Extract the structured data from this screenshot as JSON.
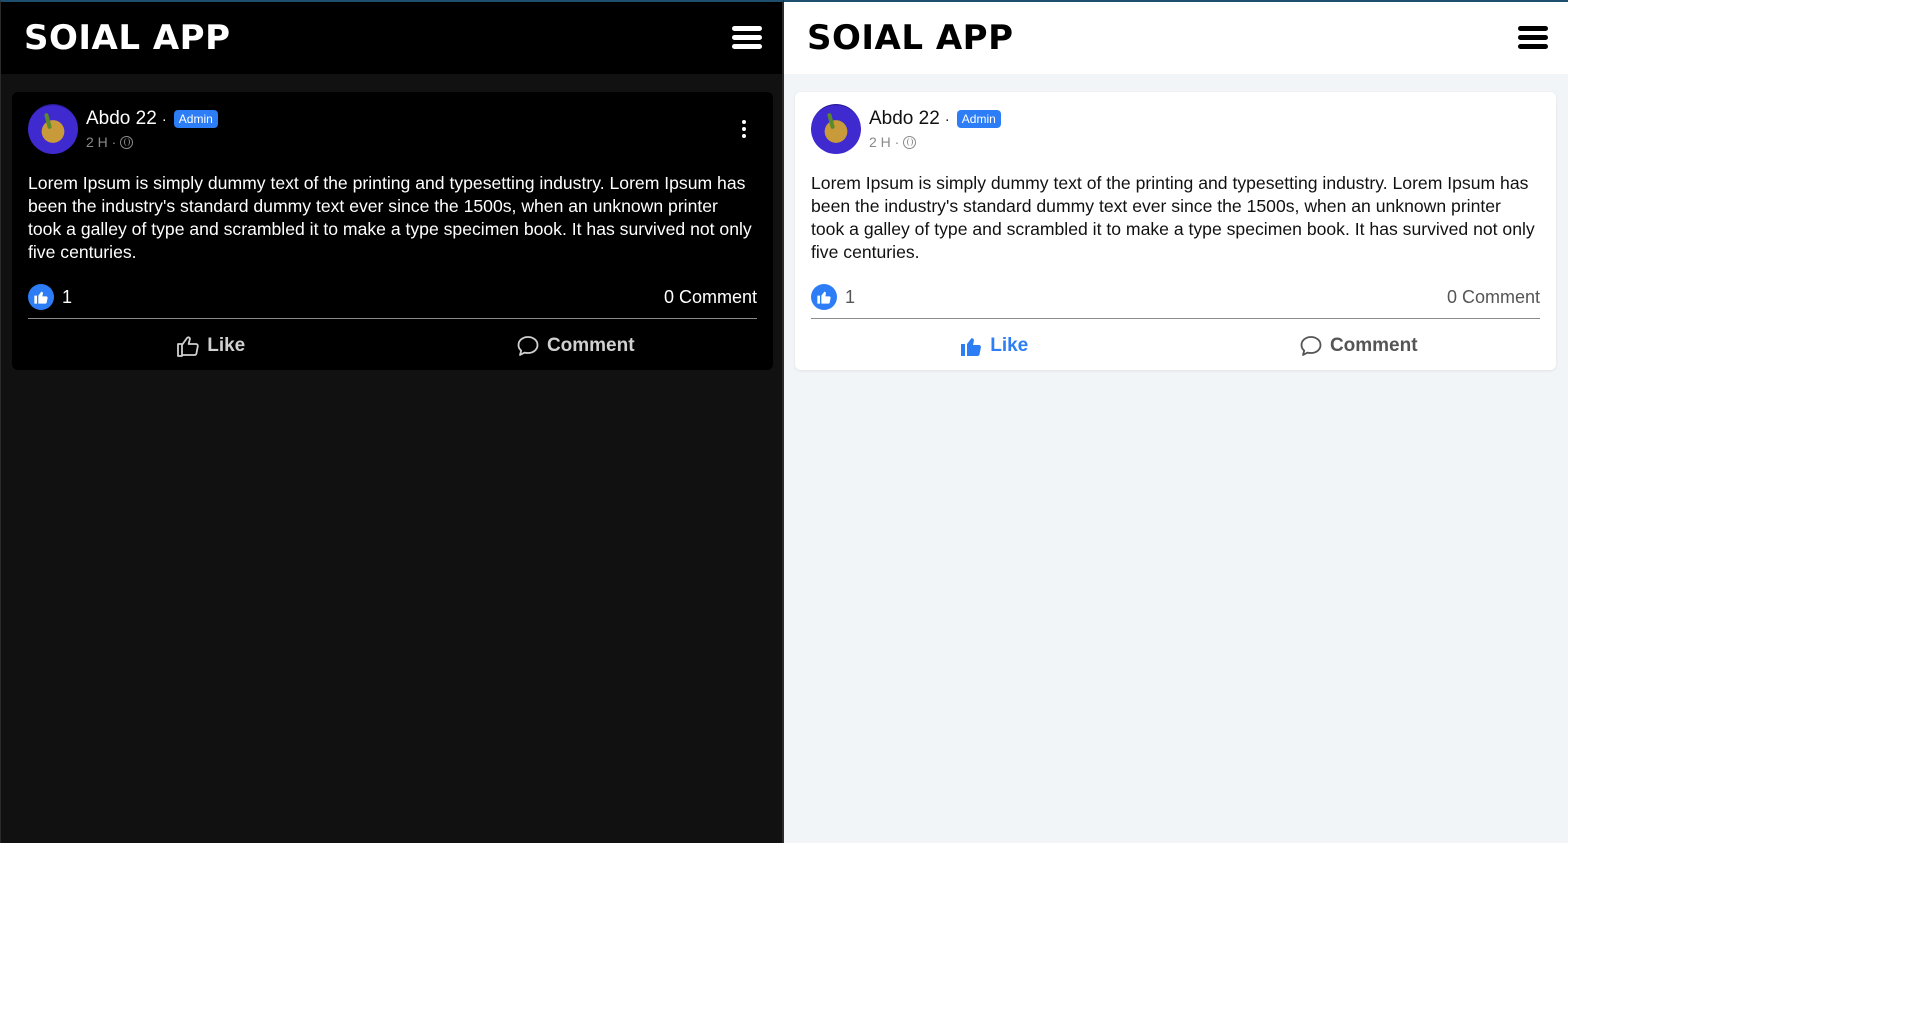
{
  "app": {
    "title": "SOIAL APP"
  },
  "post": {
    "author": "Abdo 22",
    "separator": "·",
    "badge": "Admin",
    "time": "2 H ·",
    "body": "Lorem Ipsum is simply dummy text of the printing and typesetting industry. Lorem Ipsum has been the industry's standard dummy text ever since the 1500s, when an unknown printer took a galley of type and scrambled it to make a type specimen book. It has survived not only five centuries.",
    "likes": "1",
    "comments": "0 Comment",
    "like_label": "Like",
    "comment_label": "Comment"
  },
  "colors": {
    "accent": "#2d7df6",
    "dark_bg": "#111111",
    "light_bg": "#f2f5f8"
  },
  "icons": {
    "menu": "hamburger-menu-icon",
    "more": "vertical-dots-icon",
    "globe": "globe-icon",
    "like": "thumbs-up-icon",
    "comment": "speech-bubble-icon"
  }
}
